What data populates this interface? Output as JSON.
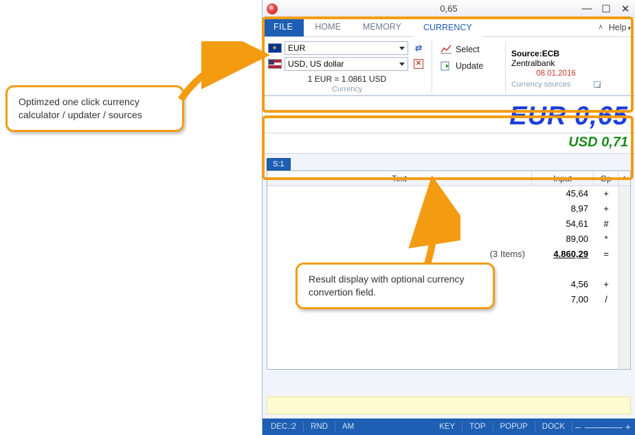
{
  "title": "0,65",
  "tabs": {
    "file": "FILE",
    "home": "HOME",
    "memory": "MEMORY",
    "currency": "CURRENCY"
  },
  "help": "Help",
  "currency": {
    "from_code": "EUR",
    "to_label": "USD, US dollar",
    "rate_line": "1 EUR = 1.0861 USD",
    "group_label": "Currency"
  },
  "actions": {
    "select": "Select",
    "update": "Update"
  },
  "sources": {
    "label_prefix": "Source:",
    "label_name": "ECB",
    "line2": "Zentralbank",
    "date": "08.01.2016",
    "group_label": "Currency sources"
  },
  "display": {
    "main": "EUR 0,65",
    "sub": "USD 0,71"
  },
  "tape": {
    "tab": "S:1",
    "headers": {
      "text": "Text",
      "input": "Input",
      "op": "Op"
    },
    "rows": [
      {
        "text": "",
        "input": "45,64",
        "op": "+"
      },
      {
        "text": "",
        "input": "8,97",
        "op": "+"
      },
      {
        "text": "",
        "input": "54,61",
        "op": "#"
      },
      {
        "text": "",
        "input": "89,00",
        "op": "*"
      },
      {
        "text": "(3 Items)",
        "input": "4.860,29",
        "op": "=",
        "result": true
      },
      {
        "text": "",
        "input": "",
        "op": ""
      },
      {
        "text": "",
        "input": "4,56",
        "op": "+"
      },
      {
        "text": "",
        "input": "7,00",
        "op": "/"
      }
    ]
  },
  "status": {
    "dec": "DEC.:2",
    "rnd": "RND",
    "am": "AM",
    "key": "KEY",
    "top": "TOP",
    "popup": "POPUP",
    "dock": "DOCK"
  },
  "callouts": {
    "c1": "Optimzed one click currency calculator / updater / sources",
    "c2": "Result display with optional currency convertion field."
  }
}
